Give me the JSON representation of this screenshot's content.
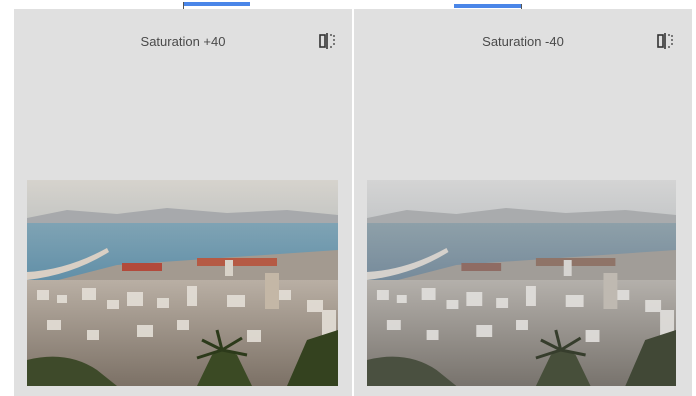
{
  "panels": [
    {
      "title": "Saturation +40",
      "saturation": 40,
      "compare_icon": "compare-split-icon"
    },
    {
      "title": "Saturation -40",
      "saturation": -40,
      "compare_icon": "compare-split-icon"
    }
  ],
  "colors": {
    "accent": "#4a86e8",
    "panel_bg": "#e0e0e0"
  }
}
